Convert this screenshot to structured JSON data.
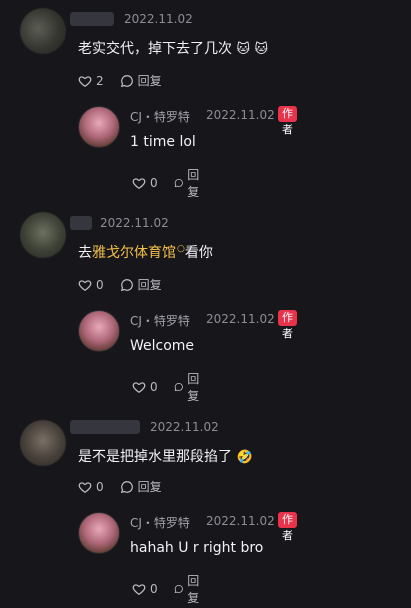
{
  "comments": [
    {
      "date": "2022.11.02",
      "text": "老实交代，掉下去了几次",
      "emoji": [
        "🐱",
        "🐱"
      ],
      "likes": "2",
      "reply_label": "回复",
      "reply": {
        "author": "CJ・特罗特",
        "date": "2022.11.02",
        "badge": "作者",
        "text": "1 time lol",
        "likes": "0",
        "reply_label": "回复"
      }
    },
    {
      "date": "2022.11.02",
      "text_prefix": "去",
      "text_link": "雅戈尔体育馆",
      "text_suffix": "看你",
      "likes": "0",
      "reply_label": "回复",
      "reply": {
        "author": "CJ・特罗特",
        "date": "2022.11.02",
        "badge": "作者",
        "text": "Welcome",
        "likes": "0",
        "reply_label": "回复"
      }
    },
    {
      "date": "2022.11.02",
      "text": "是不是把掉水里那段掐了",
      "emoji": [
        "🤣"
      ],
      "likes": "0",
      "reply_label": "回复",
      "reply": {
        "author": "CJ・特罗特",
        "date": "2022.11.02",
        "badge": "作者",
        "text": "hahah U r right bro",
        "likes": "0",
        "reply_label": "回复"
      }
    }
  ],
  "colors": {
    "background": "#16161b",
    "author_badge": "#e8334b",
    "link": "#f5c04a"
  }
}
